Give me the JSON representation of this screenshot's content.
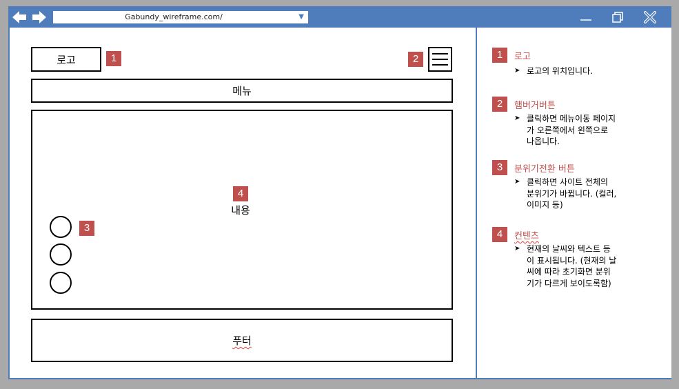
{
  "browser": {
    "url": "Gabundy_wireframe.com/"
  },
  "wireframe": {
    "logo_label": "로고",
    "menu_label": "메뉴",
    "content_label": "내용",
    "footer_label": "푸터",
    "badges": [
      "1",
      "2",
      "3",
      "4"
    ]
  },
  "annotations": [
    {
      "number": "1",
      "title": "로고",
      "body": "로고의 위치입니다."
    },
    {
      "number": "2",
      "title": "햄버거버튼",
      "body": "클릭하면 메뉴이동 페이지\n가 오른쪽에서 왼쪽으로\n나옵니다."
    },
    {
      "number": "3",
      "title": "분위기전환 버튼",
      "body": "클릭하면 사이트 전체의\n분위기가 바뀝니다. (컬러,\n이미지 등)"
    },
    {
      "number": "4",
      "title": "컨텐츠",
      "body": "현재의 날씨와 텍스트 등\n이 표시됩니다. (현재의 날\n씨에 따라 초기화면 분위\n기가 다르게 보이도록함)"
    }
  ],
  "colors": {
    "titlebar": "#4f7dbb",
    "badge": "#c0504d",
    "annotation_title": "#c0504d"
  },
  "icons": [
    "back-arrow-icon",
    "forward-arrow-icon",
    "dropdown-caret-icon",
    "minimize-icon",
    "restore-icon",
    "close-icon",
    "hamburger-icon",
    "bullet-arrow-icon"
  ]
}
